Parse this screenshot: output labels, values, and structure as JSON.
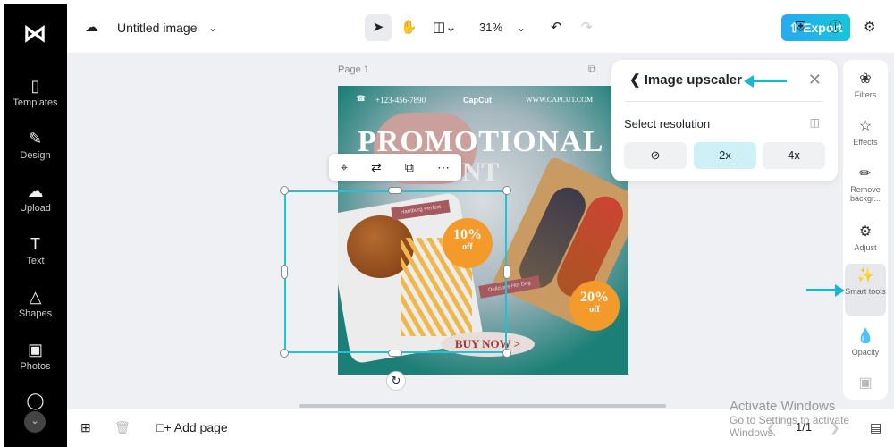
{
  "app": {
    "logo": "CapCut"
  },
  "sidebar": {
    "items": [
      {
        "label": "Templates",
        "icon": "templates-icon"
      },
      {
        "label": "Design",
        "icon": "design-icon"
      },
      {
        "label": "Upload",
        "icon": "upload-icon"
      },
      {
        "label": "Text",
        "icon": "text-icon"
      },
      {
        "label": "Shapes",
        "icon": "shapes-icon"
      },
      {
        "label": "Photos",
        "icon": "photos-icon"
      }
    ]
  },
  "header": {
    "title": "Untitled image",
    "zoom": "31%",
    "export_label": "Export"
  },
  "canvas": {
    "page_label": "Page 1"
  },
  "poster": {
    "phone": "+123-456-7890",
    "brand": "CapCut",
    "website": "WWW.CAPCUT.COM",
    "headline": "PROMOTIONAL",
    "subheadline": "DISCOUNT",
    "tag1": "Hamburg Perfect",
    "tag2": "Delicious Hot Dog",
    "badge1_value": "10%",
    "badge1_off": "off",
    "badge2_value": "20%",
    "badge2_off": "off",
    "cta": "BUY NOW >"
  },
  "upscaler": {
    "title": "Image upscaler",
    "section_label": "Select resolution",
    "options": [
      "2x",
      "4x"
    ],
    "selected": "2x"
  },
  "right_panel": {
    "items": [
      "Filters",
      "Effects",
      "Remove backgr...",
      "Adjust",
      "Smart tools",
      "Opacity"
    ],
    "active": "Smart tools"
  },
  "bottom": {
    "add_page": "Add page",
    "page_count": "1/1"
  },
  "watermark": {
    "line1": "Activate Windows",
    "line2": "Go to Settings to activate Windows."
  },
  "colors": {
    "accent": "#15b7d3",
    "export_start": "#2aa8f0",
    "export_end": "#16c6da",
    "sidebar": "#000000"
  }
}
